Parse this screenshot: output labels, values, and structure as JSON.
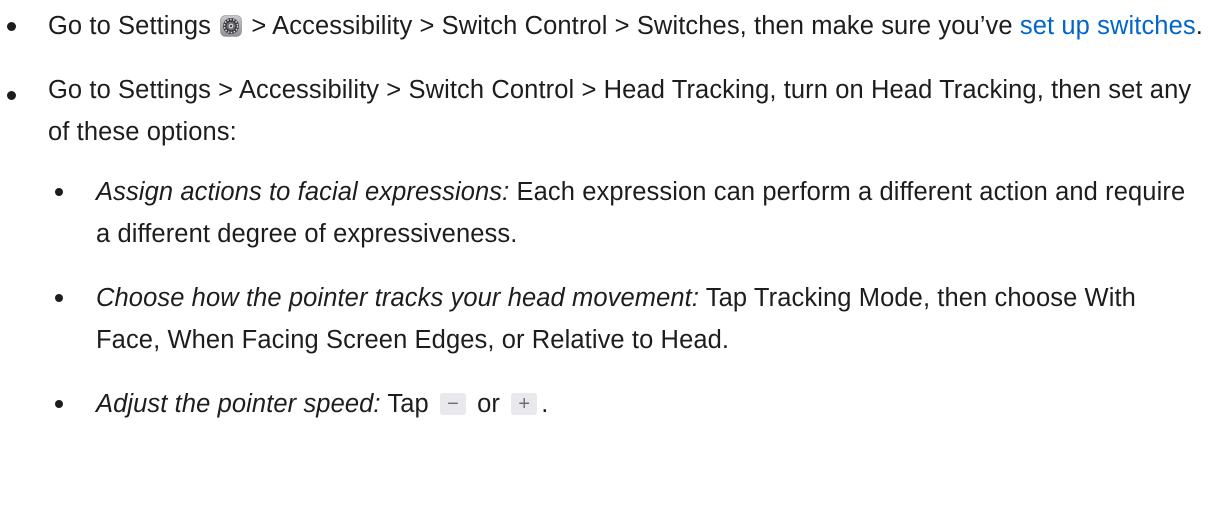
{
  "item1": {
    "text_before_icon": "Go to Settings",
    "settings_icon": "settings-gear-icon",
    "text_after_icon": "> Accessibility > Switch Control > Switches, then make sure you’ve",
    "link": "set up switches",
    "text_after_link": "."
  },
  "item2": {
    "text": "Go to Settings > Accessibility > Switch Control > Head Tracking, turn on Head Tracking, then set any of these options:",
    "subitems": [
      {
        "label": "Assign actions to facial expressions:",
        "text": "Each expression can perform a different action and require a different degree of expressiveness."
      },
      {
        "label": "Choose how the pointer tracks your head movement:",
        "text": "Tap Tracking Mode, then choose With Face, When Facing Screen Edges, or Relative to Head."
      },
      {
        "label": "Adjust the pointer speed:",
        "text_before": "Tap",
        "minus_key": "−",
        "text_between": "or",
        "plus_key": "+",
        "text_after": "."
      }
    ]
  },
  "colors": {
    "text": "#1d1d1f",
    "link": "#0066cc",
    "key_bg": "#e8e8ed"
  }
}
